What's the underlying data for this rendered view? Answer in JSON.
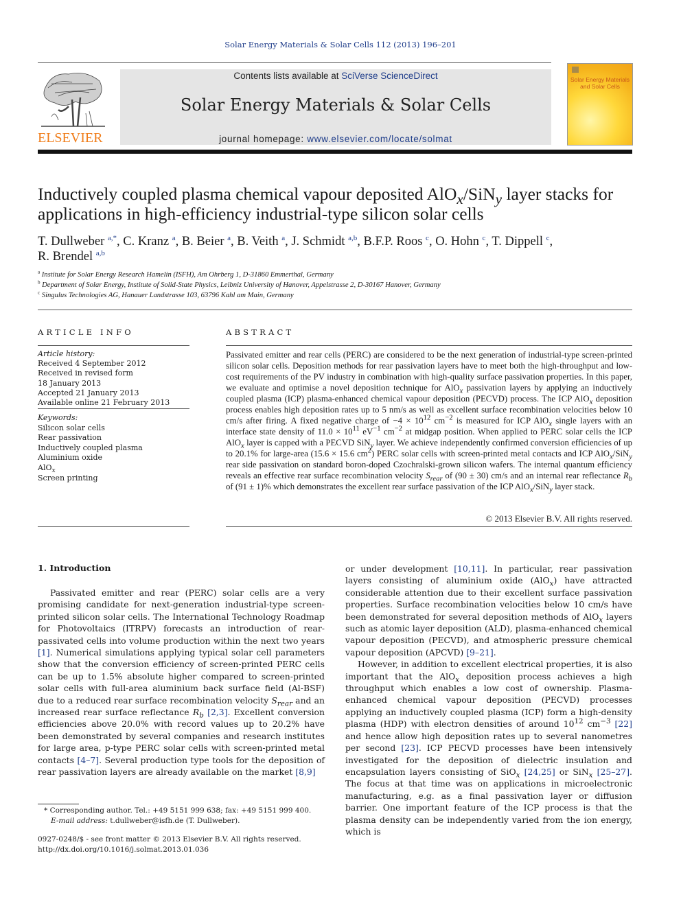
{
  "running_head": "Solar Energy Materials & Solar Cells 112 (2013) 196–201",
  "masthead": {
    "publisher_logo_text": "ELSEVIER",
    "contents_prefix": "Contents lists available at ",
    "contents_link": "SciVerse ScienceDirect",
    "journal_title": "Solar Energy Materials & Solar Cells",
    "homepage_prefix": "journal homepage: ",
    "homepage_link": "www.elsevier.com/locate/solmat",
    "cover_title_line1": "Solar Energy Materials",
    "cover_title_line2": "and Solar Cells",
    "brand_orange": "#f07d1a",
    "link_blue": "#1f3d8a"
  },
  "article": {
    "title_part1": "Inductively coupled plasma chemical vapour deposited AlO",
    "title_sub_x": "x",
    "title_part2": "/SiN",
    "title_sub_y": "y",
    "title_part3": " layer stacks for applications in high-efficiency industrial-type silicon solar cells",
    "authors": [
      {
        "name": "T. Dullweber",
        "aff": "a,*"
      },
      {
        "name": "C. Kranz",
        "aff": "a"
      },
      {
        "name": "B. Beier",
        "aff": "a"
      },
      {
        "name": "B. Veith",
        "aff": "a"
      },
      {
        "name": "J. Schmidt",
        "aff": "a,b"
      },
      {
        "name": "B.F.P. Roos",
        "aff": "c"
      },
      {
        "name": "O. Hohn",
        "aff": "c"
      },
      {
        "name": "T. Dippell",
        "aff": "c"
      },
      {
        "name": "R. Brendel",
        "aff": "a,b"
      }
    ],
    "affiliations": [
      {
        "mark": "a",
        "text": "Institute for Solar Energy Research Hamelin (ISFH), Am Ohrberg 1, D-31860 Emmerthal, Germany"
      },
      {
        "mark": "b",
        "text": "Department of Solar Energy, Institute of Solid-State Physics, Leibniz University of Hanover, Appelstrasse 2, D-30167 Hanover, Germany"
      },
      {
        "mark": "c",
        "text": "Singulus Technologies AG, Hanauer Landstrasse 103, 63796 Kahl am Main, Germany"
      }
    ]
  },
  "article_info": {
    "heading": "ARTICLE INFO",
    "history_label": "Article history:",
    "history": [
      "Received 4 September 2012",
      "Received in revised form",
      "18 January 2013",
      "Accepted 21 January 2013",
      "Available online 21 February 2013"
    ],
    "keywords_label": "Keywords:",
    "keywords": [
      "Silicon solar cells",
      "Rear passivation",
      "Inductively coupled plasma",
      "Aluminium oxide",
      "AlOx",
      "Screen printing"
    ]
  },
  "abstract": {
    "heading": "ABSTRACT",
    "s1": "Passivated emitter and rear cells (PERC) are considered to be the next generation of industrial-type screen-printed silicon solar cells. Deposition methods for rear passivation layers have to meet both the high-throughput and low-cost requirements of the PV industry in combination with high-quality surface passivation properties. In this paper, we evaluate and optimise a novel deposition technique for AlO",
    "s2": " passivation layers by applying an inductively coupled plasma (ICP) plasma-enhanced chemical vapour deposition (PECVD) process. The ICP AlO",
    "s3": " deposition process enables high deposition rates up to 5 nm/s as well as excellent surface recombination velocities below 10 cm/s after firing. A fixed negative charge of −4 × 10",
    "s3_exp": "12",
    "s4": " cm",
    "s4_exp": "−2",
    "s5": " is measured for ICP AlO",
    "s6": " single layers with an interface state density of 11.0 × 10",
    "s6_exp": "11",
    "s7": " eV",
    "s7_exp": "−1",
    "s8": " cm",
    "s8_exp": "−2",
    "s9": " at midgap position. When applied to PERC solar cells the ICP AlO",
    "s10": " layer is capped with a PECVD SiN",
    "s11": " layer. We achieve independently confirmed conversion efficiencies of up to 20.1% for large-area (15.6 × 15.6 cm",
    "s11_exp": "2",
    "s12": ") PERC solar cells with screen-printed metal contacts and ICP AlO",
    "s13": "/SiN",
    "s14": " rear side passivation on standard boron-doped Czochralski-grown silicon wafers. The internal quantum efficiency reveals an effective rear surface recombination velocity ",
    "s_rear": "S",
    "s_rear_sub": "rear",
    "s15": " of (90 ± 30) cm/s and an internal rear reflectance ",
    "r_b": "R",
    "r_b_sub": "b",
    "s16": " of (91 ± 1)% which demonstrates the excellent rear surface passivation of the ICP AlO",
    "s17": "/SiN",
    "s18": " layer stack.",
    "sub_x": "x",
    "sub_y": "y",
    "copyright": "© 2013 Elsevier B.V. All rights reserved."
  },
  "body": {
    "section_heading": "1.  Introduction",
    "left_p1a": "Passivated emitter and rear (PERC) solar cells are a very promising candidate for next-generation industrial-type screen-printed silicon solar cells. The International Technology Roadmap for Photovoltaics (ITRPV) forecasts an introduction of rear-passivated cells into volume production within the next two years ",
    "ref1": "[1]",
    "left_p1b": ". Numerical simulations applying typical solar cell parameters show that the conversion efficiency of screen-printed PERC cells can be up to 1.5% absolute higher compared to screen-printed solar cells with full-area aluminium back surface field (Al-BSF) due to a reduced rear surface recombination velocity ",
    "left_p1c": " and an increased rear surface reflectance ",
    "ref23": "[2,3]",
    "left_p1d": ". Excellent conversion efficiencies above 20.0% with record values up to 20.2% have been demonstrated by several companies and research institutes for large area, p-type PERC solar cells with screen-printed metal contacts ",
    "ref47": "[4–7]",
    "left_p1e": ". Several production type tools for the deposition of rear passivation layers are already available on the market ",
    "ref89": "[8,9]",
    "right_p1a": "or under development ",
    "ref1011": "[10,11]",
    "right_p1b": ". In particular, rear passivation layers consisting of aluminium oxide (AlO",
    "right_p1c": ") have attracted considerable attention due to their excellent surface passivation properties. Surface recombination velocities below 10 cm/s have been demonstrated for several deposition methods of AlO",
    "right_p1d": " layers such as atomic layer deposition (ALD), plasma-enhanced chemical vapour deposition (PECVD), and atmospheric pressure chemical vapour deposition (APCVD) ",
    "ref921": "[9–21]",
    "right_p2a": "However, in addition to excellent electrical properties, it is also important that the AlO",
    "right_p2b": " deposition process achieves a high throughput which enables a low cost of ownership. Plasma-enhanced chemical vapour deposition (PECVD) processes applying an inductively coupled plasma (ICP) form a high-density plasma (HDP) with electron densities of around 10",
    "exp12": "12",
    "right_p2c": " cm",
    "exp_m3": "−3",
    "ref22": "[22]",
    "right_p2d": " and hence allow high deposition rates up to several nanometres per second ",
    "ref23b": "[23]",
    "right_p2e": ". ICP PECVD processes have been intensively investigated for the deposition of dielectric insulation and encapsulation layers consisting of SiO",
    "ref2425": "[24,25]",
    "right_p2f": " or SiN",
    "ref2527": "[25–27]",
    "right_p2g": ". The focus at that time was on applications in microelectronic manufacturing, e.g. as a final passivation layer or diffusion barrier. One important feature of the ICP process is that the plasma density can be independently varied from the ion energy, which is"
  },
  "footnote": {
    "line1": "* Corresponding author. Tel.: +49 5151 999 638; fax: +49 5151 999 400.",
    "email_label": "E-mail address:",
    "email": " t.dullweber@isfh.de (T. Dullweber).",
    "front_matter": "0927-0248/$ - see front matter © 2013 Elsevier B.V. All rights reserved.",
    "doi": "http://dx.doi.org/10.1016/j.solmat.2013.01.036"
  }
}
